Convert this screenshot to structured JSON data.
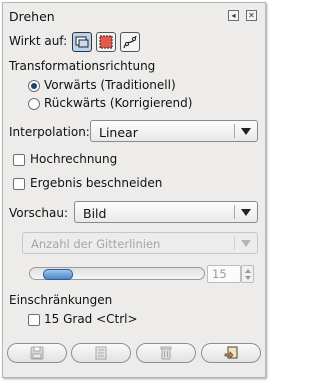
{
  "dialog": {
    "title": "Drehen"
  },
  "header_buttons": [
    {
      "icon": "left-arrow-icon"
    },
    {
      "icon": "close-icon"
    }
  ],
  "affects": {
    "label": "Wirkt auf:",
    "buttons": [
      {
        "icon": "layer-icon",
        "active": true
      },
      {
        "icon": "selection-icon",
        "active": false
      },
      {
        "icon": "path-icon",
        "active": false
      }
    ]
  },
  "direction": {
    "label": "Transformationsrichtung",
    "options": [
      {
        "label": "Vorwärts (Traditionell)",
        "selected": true
      },
      {
        "label": "Rückwärts (Korrigierend)",
        "selected": false
      }
    ]
  },
  "interpolation": {
    "label": "Interpolation:",
    "value": "Linear"
  },
  "supersampling": {
    "label": "Hochrechnung",
    "checked": false
  },
  "clip_result": {
    "label": "Ergebnis beschneiden",
    "checked": false
  },
  "preview": {
    "label": "Vorschau:",
    "value": "Bild"
  },
  "grid": {
    "placeholder": "Anzahl der Gitterlinien",
    "value": "15",
    "slider_fraction": 0.15
  },
  "constraints": {
    "label": "Einschränkungen",
    "option_label": "15 Grad  <Ctrl>",
    "checked": false
  },
  "footer_buttons": [
    {
      "icon": "save-icon"
    },
    {
      "icon": "restore-icon"
    },
    {
      "icon": "delete-icon"
    },
    {
      "icon": "reset-icon"
    }
  ],
  "colors": {
    "panel_bg": "#edeceb",
    "accent": "#4f86c6",
    "active_tool": "#b9d4ee"
  }
}
